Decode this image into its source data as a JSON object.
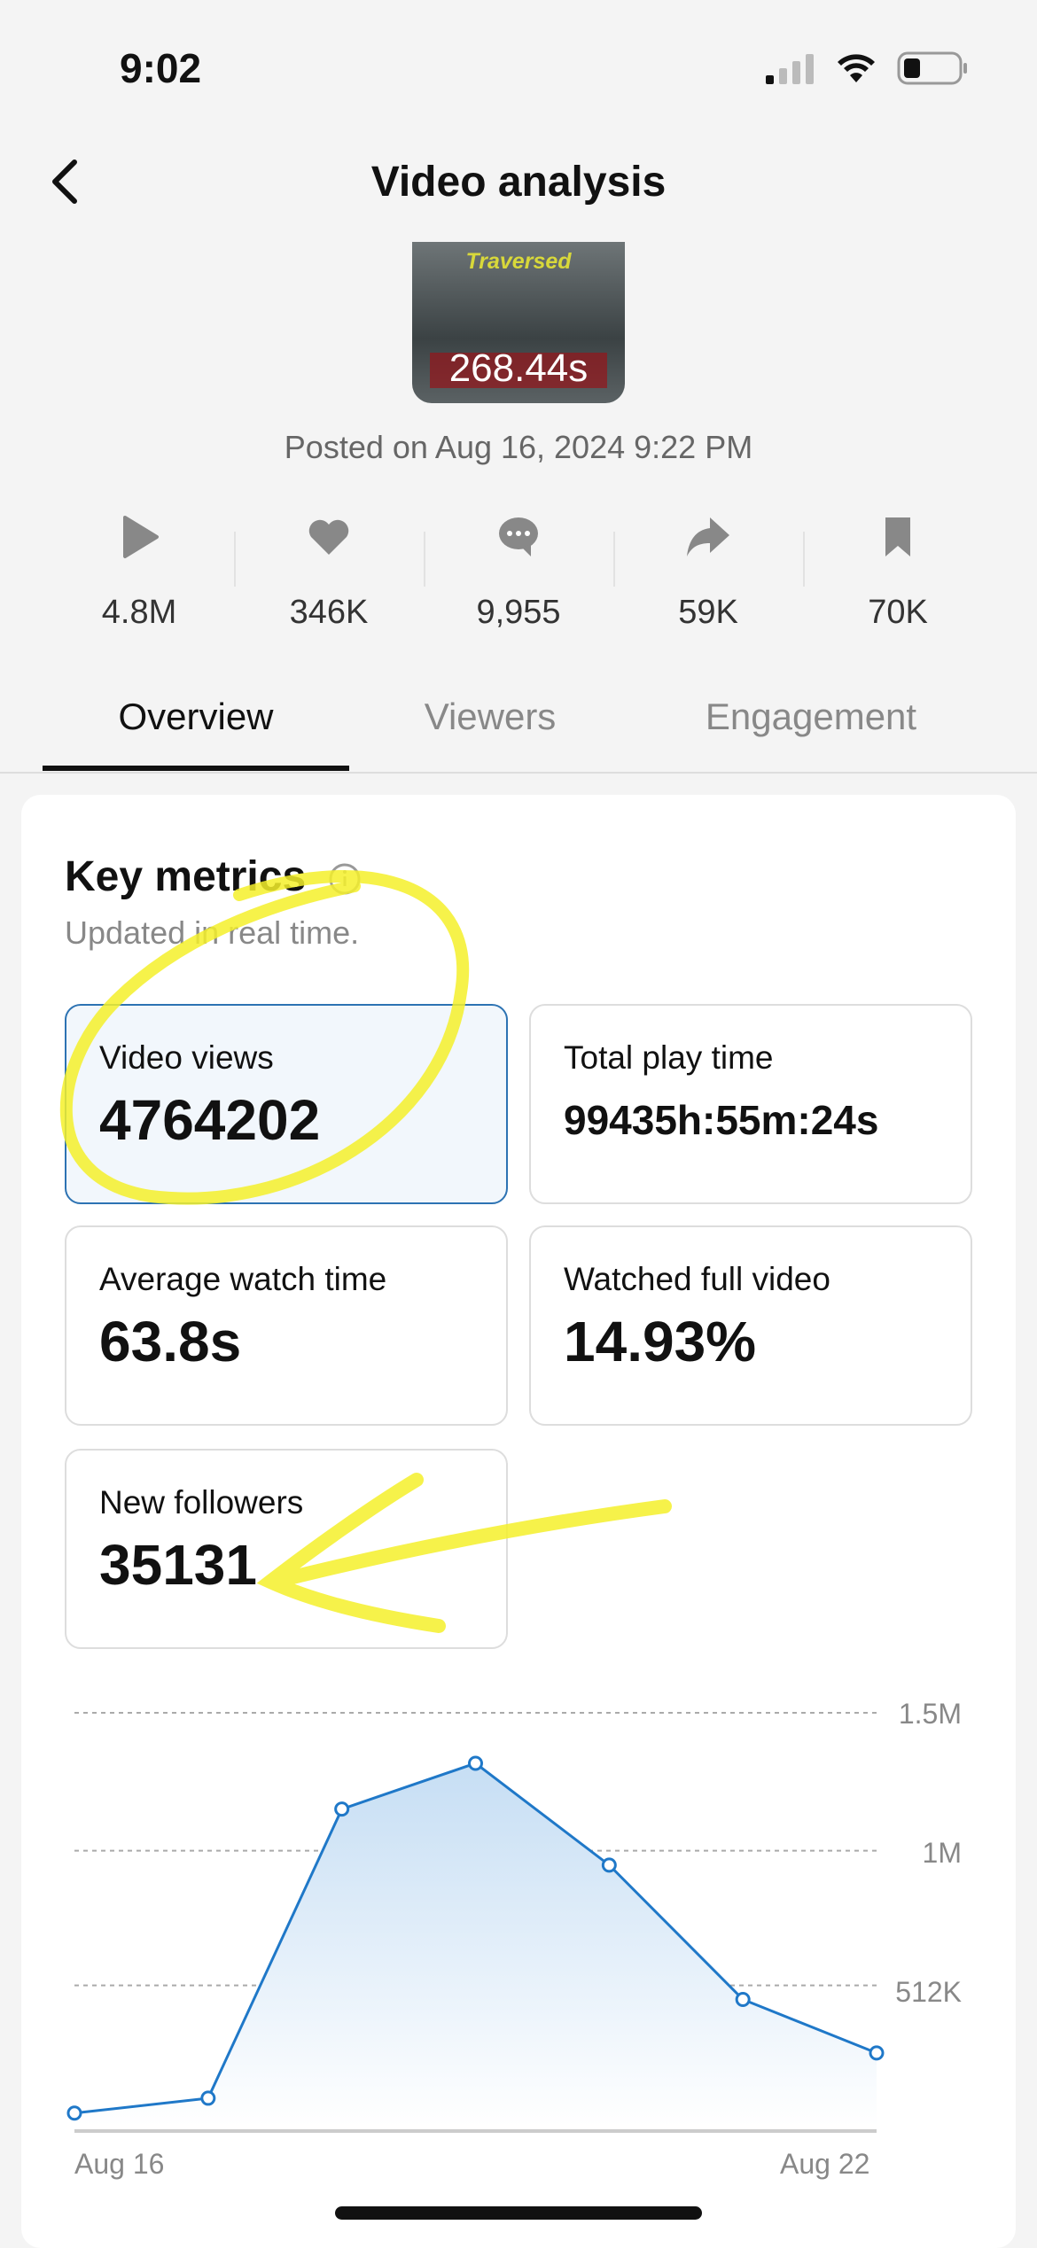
{
  "status_bar": {
    "time": "9:02"
  },
  "header": {
    "title": "Video analysis"
  },
  "video": {
    "thumbnail_title": "Traversed",
    "duration": "268.44s",
    "posted": "Posted on Aug 16, 2024 9:22 PM"
  },
  "stats": [
    {
      "icon": "play-icon",
      "value": "4.8M"
    },
    {
      "icon": "heart-icon",
      "value": "346K"
    },
    {
      "icon": "comment-icon",
      "value": "9,955"
    },
    {
      "icon": "share-icon",
      "value": "59K"
    },
    {
      "icon": "bookmark-icon",
      "value": "70K"
    }
  ],
  "tabs": [
    {
      "label": "Overview",
      "active": true
    },
    {
      "label": "Viewers"
    },
    {
      "label": "Engagement"
    }
  ],
  "key_metrics": {
    "title": "Key metrics",
    "subtitle": "Updated in real time.",
    "items": [
      {
        "label": "Video views",
        "value": "4764202",
        "selected": true
      },
      {
        "label": "Total play time",
        "value": "99435h:55m:24s"
      },
      {
        "label": "Average watch time",
        "value": "63.8s"
      },
      {
        "label": "Watched full video",
        "value": "14.93%"
      },
      {
        "label": "New followers",
        "value": "35131"
      }
    ]
  },
  "chart_data": {
    "type": "area",
    "x": [
      "Aug 16",
      "Aug 17",
      "Aug 18",
      "Aug 19",
      "Aug 20",
      "Aug 21",
      "Aug 22"
    ],
    "x_tick_labels": [
      "Aug 16",
      "Aug 22"
    ],
    "values": [
      49000,
      103000,
      1151000,
      1317000,
      948000,
      461000,
      267000
    ],
    "y_ticks": [
      {
        "value": 512000,
        "label": "512K"
      },
      {
        "value": 1000000,
        "label": "1M"
      },
      {
        "value": 1500000,
        "label": "1.5M"
      }
    ],
    "ylim": [
      0,
      1500000
    ],
    "grid": true,
    "color": "#1f78c8"
  },
  "colors": {
    "accent": "#1f78c8",
    "annotation": "#f5f02a"
  }
}
